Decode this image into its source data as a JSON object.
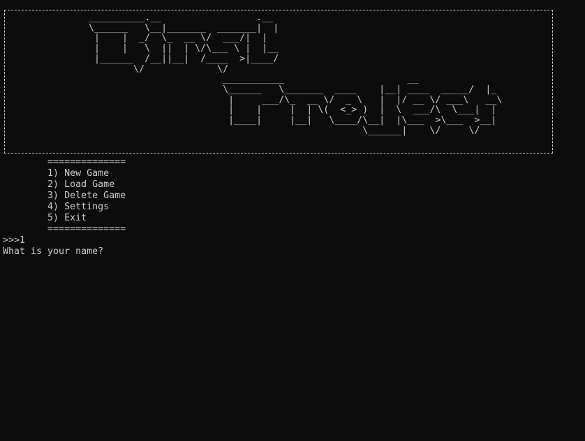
{
  "banner": {
    "ascii_art": "  __________.__                 .__\n  \\______   \\__|_______  _______|  |\n   |    |  _/  \\_  __ \\/  ___/|  |\n   |    |   \\  ||  | \\/\\___ \\ |  |__\n   |______  /__||__|  /____  >|____/\n          \\/             \\/\n                          ___________                      __\n                          \\______   \\_______  ____    |__| ____  _____/  |_\n                           |     ___/\\_  __ \\/  _ \\   |  |/ __ \\/ ___\\   __\\\n                           |    |     |  | \\(  <_> )  |  \\  ___/\\  \\___|  |\n                           |____|     |__|   \\____/\\__|  |\\___  >\\___  >__|\n                                                   \\______|    \\/     \\/"
  },
  "menu": {
    "separator": "==============",
    "items": [
      "1) New Game",
      "2) Load Game",
      "3) Delete Game",
      "4) Settings",
      "5) Exit"
    ]
  },
  "console": {
    "prompt": ">>>",
    "input_value": "1",
    "question": "What is your name?"
  },
  "colors": {
    "background": "#0c0c0c",
    "foreground": "#cccccc"
  }
}
